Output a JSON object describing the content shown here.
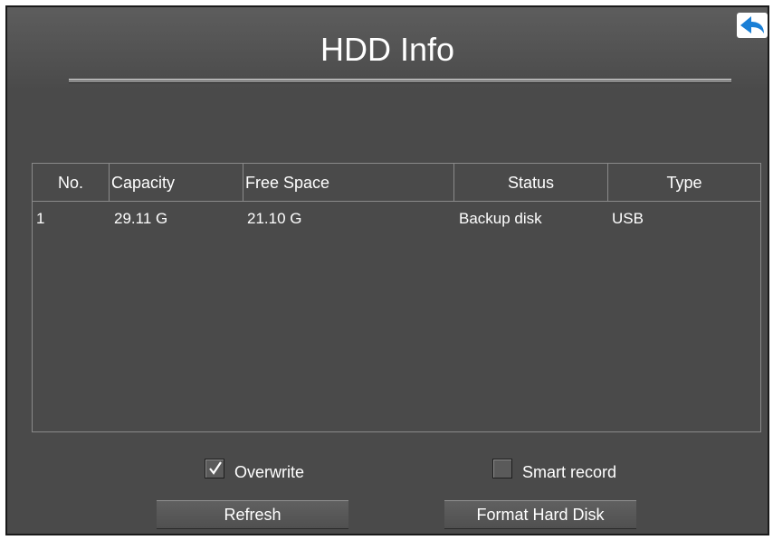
{
  "window": {
    "title": "HDD Info"
  },
  "table": {
    "headers": [
      "No.",
      "Capacity",
      "Free Space",
      "Status",
      "Type"
    ],
    "rows": [
      {
        "no": "1",
        "capacity": "29.11 G",
        "free_space": "21.10 G",
        "status": "Backup disk",
        "type": "USB"
      }
    ]
  },
  "options": {
    "overwrite": {
      "label": "Overwrite",
      "checked": true
    },
    "smart_record": {
      "label": "Smart record",
      "checked": false
    }
  },
  "buttons": {
    "refresh": "Refresh",
    "format": "Format Hard Disk"
  }
}
